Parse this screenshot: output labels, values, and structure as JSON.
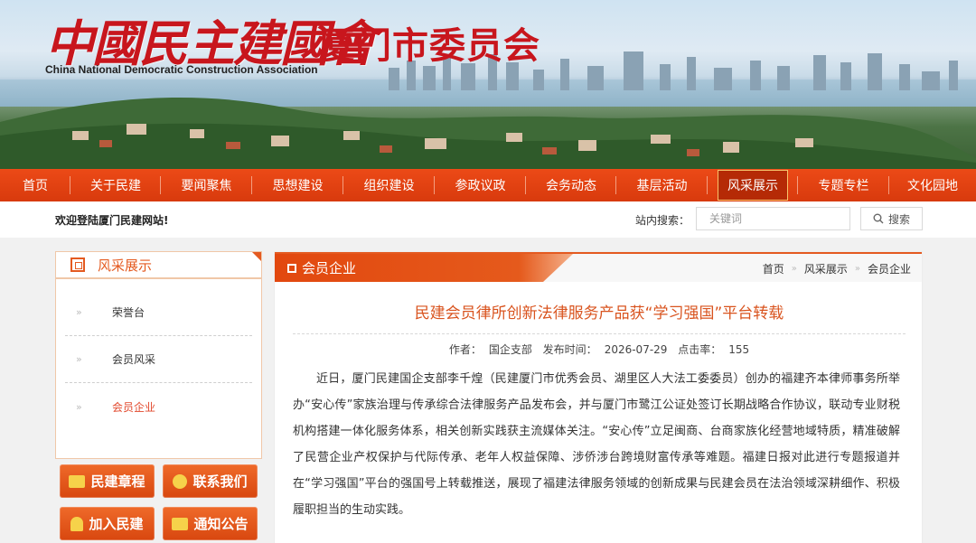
{
  "header": {
    "logo_cn": "中國民主建國會",
    "logo_en": "China National Democratic Construction Association",
    "city_title": "厦门市委员会"
  },
  "nav": {
    "items": [
      {
        "label": "首页"
      },
      {
        "label": "关于民建"
      },
      {
        "label": "要闻聚焦"
      },
      {
        "label": "思想建设"
      },
      {
        "label": "组织建设"
      },
      {
        "label": "参政议政"
      },
      {
        "label": "会务动态"
      },
      {
        "label": "基层活动"
      },
      {
        "label": "风采展示"
      },
      {
        "label": "专题专栏"
      },
      {
        "label": "文化园地"
      }
    ],
    "active": "风采展示"
  },
  "topbar": {
    "welcome": "欢迎登陆厦门民建网站!",
    "search_label": "站内搜索：",
    "search_placeholder": "关键词",
    "search_button": "搜索"
  },
  "sidebar": {
    "title": "风采展示",
    "items": [
      {
        "label": "荣誉台",
        "arrow": "»"
      },
      {
        "label": "会员风采",
        "arrow": "»"
      },
      {
        "label": "会员企业",
        "arrow": "»"
      }
    ],
    "active": "会员企业",
    "buttons": [
      {
        "label": "民建章程"
      },
      {
        "label": "联系我们"
      },
      {
        "label": "加入民建"
      },
      {
        "label": "通知公告"
      }
    ]
  },
  "main": {
    "tab_title": "会员企业",
    "breadcrumb": [
      "首页",
      "风采展示",
      "会员企业"
    ],
    "breadcrumb_sep": "»",
    "article": {
      "title": "民建会员律所创新法律服务产品获“学习强国”平台转载",
      "author_label": "作者：",
      "author": "国企支部",
      "date_label": "发布时间：",
      "date": "2026-07-29",
      "hits_label": "点击率：",
      "hits": "155",
      "body": "近日，厦门民建国企支部李千煌（民建厦门市优秀会员、湖里区人大法工委委员）创办的福建齐本律师事务所举办“安心传”家族治理与传承综合法律服务产品发布会，并与厦门市鹭江公证处签订长期战略合作协议，联动专业财税机构搭建一体化服务体系，相关创新实践获主流媒体关注。“安心传”立足闽商、台商家族化经营地域特质，精准破解了民营企业产权保护与代际传承、老年人权益保障、涉侨涉台跨境财富传承等难题。福建日报对此进行专题报道并在“学习强国”平台的强国号上转载推送，展现了福建法律服务领域的创新成果与民建会员在法治领域深耕细作、积极履职担当的生动实践。"
    }
  },
  "colors": {
    "brand_red": "#c8161d",
    "nav_orange": "#e04412",
    "accent_orange": "#e45a20",
    "title_orange": "#d9541f"
  }
}
